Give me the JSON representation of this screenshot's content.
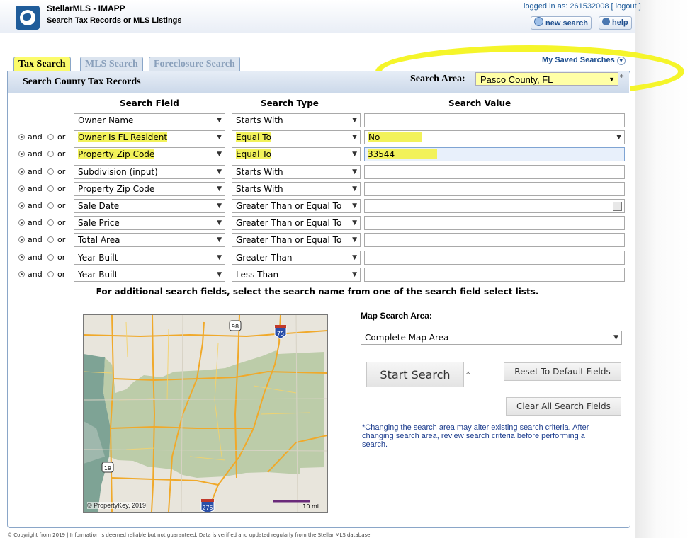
{
  "header": {
    "app_title": "StellarMLS - IMAPP",
    "subtitle": "Search Tax Records or MLS Listings",
    "logged_in_label": "logged in as: 261532008",
    "logout": "logout",
    "new_search": "new search",
    "help": "help"
  },
  "tabs": [
    "Tax Search",
    "MLS Search",
    "Foreclosure Search"
  ],
  "saved_searches": "My Saved Searches",
  "panel": {
    "title": "Search County Tax Records",
    "search_area_label": "Search Area:",
    "search_area_value": "Pasco County, FL",
    "required_mark": "*"
  },
  "columns": {
    "field": "Search Field",
    "type": "Search Type",
    "value": "Search Value"
  },
  "connector": {
    "and": "and",
    "or": "or"
  },
  "rows": [
    {
      "field": "Owner Name",
      "type": "Starts With",
      "value": "",
      "value_kind": "text",
      "conn": ""
    },
    {
      "field": "Owner Is FL Resident",
      "type": "Equal To",
      "value": "No",
      "value_kind": "select",
      "conn": "and"
    },
    {
      "field": "Property Zip Code",
      "type": "Equal To",
      "value": "33544",
      "value_kind": "text-focus",
      "conn": "and"
    },
    {
      "field": "Subdivision (input)",
      "type": "Starts With",
      "value": "",
      "value_kind": "text",
      "conn": "and"
    },
    {
      "field": "Property Zip Code",
      "type": "Starts With",
      "value": "",
      "value_kind": "text",
      "conn": "and"
    },
    {
      "field": "Sale Date",
      "type": "Greater Than or Equal To",
      "value": "",
      "value_kind": "date",
      "conn": "and"
    },
    {
      "field": "Sale Price",
      "type": "Greater Than or Equal To",
      "value": "",
      "value_kind": "text",
      "conn": "and"
    },
    {
      "field": "Total Area",
      "type": "Greater Than or Equal To",
      "value": "",
      "value_kind": "text",
      "conn": "and"
    },
    {
      "field": "Year Built",
      "type": "Greater Than",
      "value": "",
      "value_kind": "text",
      "conn": "and"
    },
    {
      "field": "Year Built",
      "type": "Less Than",
      "value": "",
      "value_kind": "text",
      "conn": "and"
    }
  ],
  "hint": "For additional search fields, select the search name from one of the search field select lists.",
  "map": {
    "copyright": "© PropertyKey, 2019",
    "scale": "10 mi",
    "shields": [
      "98",
      "75",
      "19",
      "275"
    ],
    "search_area_label": "Map Search Area:",
    "search_area_value": "Complete Map Area"
  },
  "buttons": {
    "start": "Start Search",
    "reset": "Reset To Default Fields",
    "clear": "Clear All Search Fields"
  },
  "note": "*Changing the search area may alter existing search criteria. After changing search area, review search criteria before performing a search.",
  "colors": {
    "highlight": "#f5f52a",
    "link": "#1f4f8f",
    "panel_border": "#8aa6c8"
  }
}
